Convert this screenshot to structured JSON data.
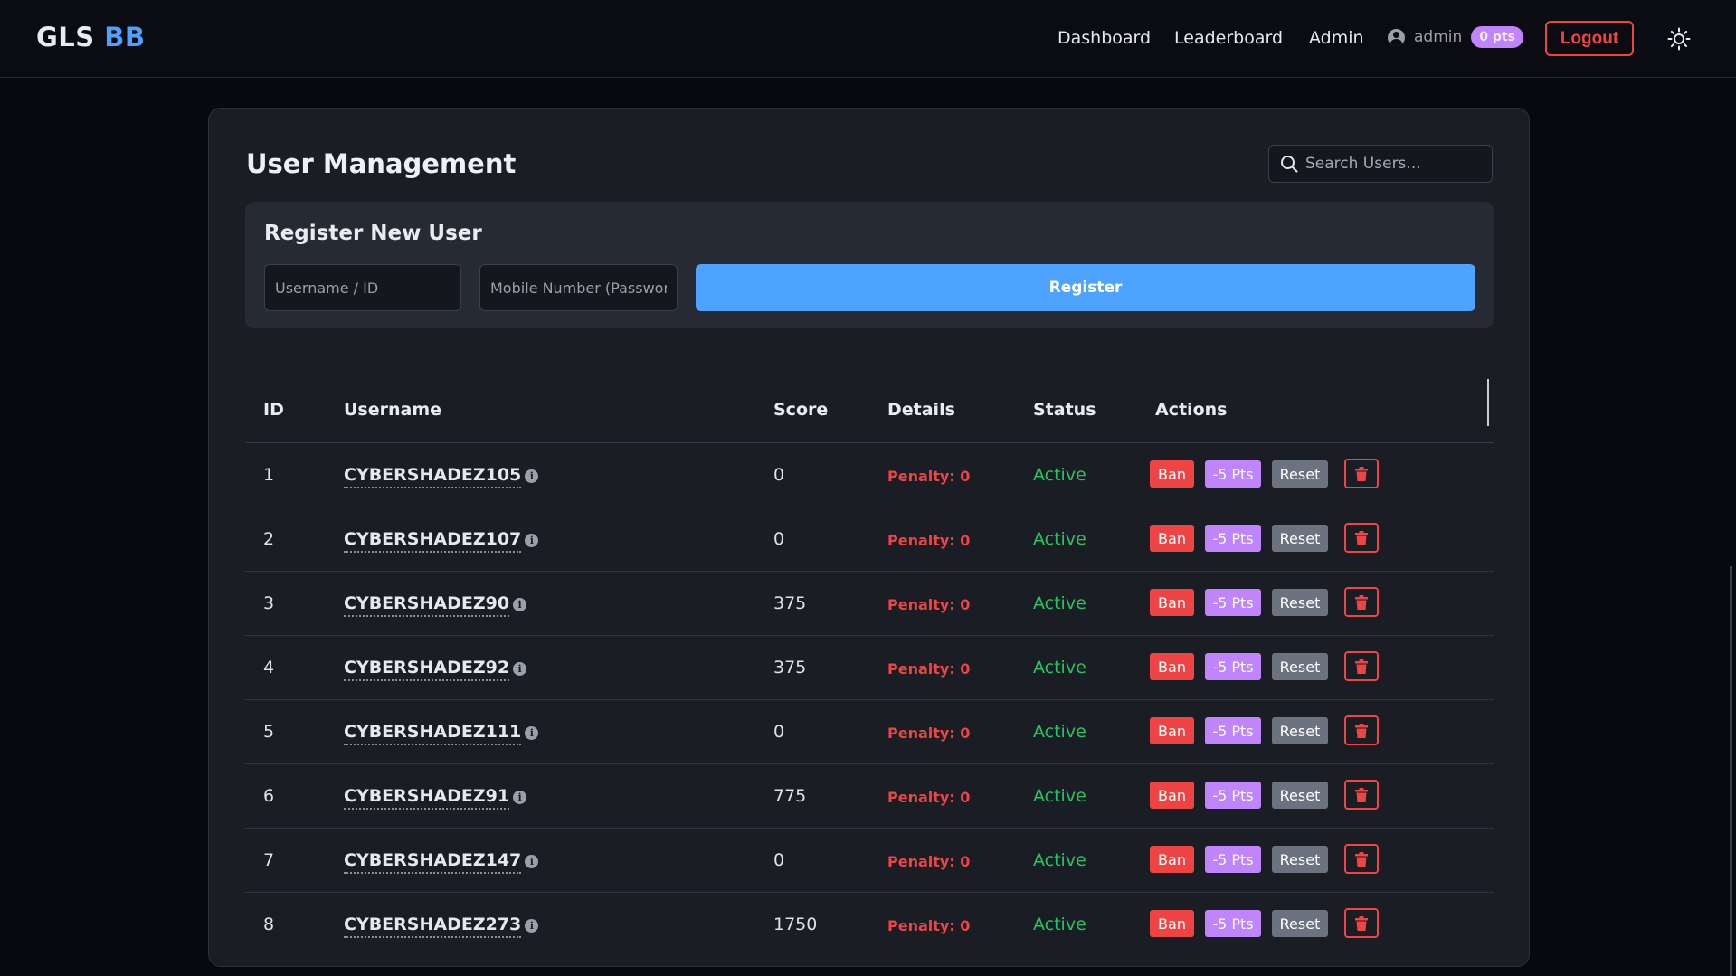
{
  "nav": {
    "brand_main": "GLS",
    "brand_accent": "BB",
    "links": [
      "Dashboard",
      "Leaderboard",
      "Admin"
    ],
    "user_name": "admin",
    "points_badge": "0 pts",
    "logout_label": "Logout",
    "theme_icon": "sun-icon"
  },
  "page": {
    "title": "User Management",
    "search_placeholder": "Search Users..."
  },
  "register": {
    "title": "Register New User",
    "username_placeholder": "Username / ID",
    "password_placeholder": "Mobile Number (Password)",
    "button_label": "Register"
  },
  "table": {
    "headers": [
      "ID",
      "Username",
      "Score",
      "Details",
      "Status",
      "Actions"
    ],
    "rows": [
      {
        "id": "1",
        "username": "CYBERSHADEZ105",
        "score": "0",
        "details": "Penalty: 0",
        "status": "Active"
      },
      {
        "id": "2",
        "username": "CYBERSHADEZ107",
        "score": "0",
        "details": "Penalty: 0",
        "status": "Active"
      },
      {
        "id": "3",
        "username": "CYBERSHADEZ90",
        "score": "375",
        "details": "Penalty: 0",
        "status": "Active"
      },
      {
        "id": "4",
        "username": "CYBERSHADEZ92",
        "score": "375",
        "details": "Penalty: 0",
        "status": "Active"
      },
      {
        "id": "5",
        "username": "CYBERSHADEZ111",
        "score": "0",
        "details": "Penalty: 0",
        "status": "Active"
      },
      {
        "id": "6",
        "username": "CYBERSHADEZ91",
        "score": "775",
        "details": "Penalty: 0",
        "status": "Active"
      },
      {
        "id": "7",
        "username": "CYBERSHADEZ147",
        "score": "0",
        "details": "Penalty: 0",
        "status": "Active"
      },
      {
        "id": "8",
        "username": "CYBERSHADEZ273",
        "score": "1750",
        "details": "Penalty: 0",
        "status": "Active"
      }
    ],
    "actions": {
      "ban": "Ban",
      "deduct": "-5 Pts",
      "reset": "Reset",
      "delete_icon": "trash-icon"
    }
  },
  "colors": {
    "accent_blue": "#4da3ff",
    "danger_red": "#ef4444",
    "purple": "#c084fc",
    "success_green": "#22c55e",
    "gray": "#6b7280"
  }
}
